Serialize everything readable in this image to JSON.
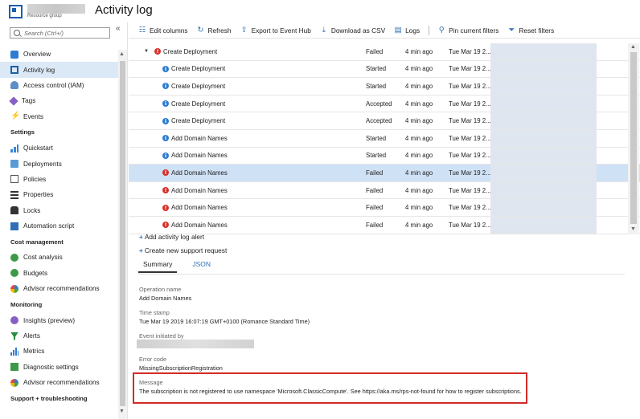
{
  "header": {
    "resource_subtitle": "Resource group",
    "page_title": "Activity log"
  },
  "sidebar": {
    "search_placeholder": "Search (Ctrl+/)",
    "collapse": "«",
    "items_top": [
      {
        "label": "Overview",
        "icon": "overview-icon"
      },
      {
        "label": "Activity log",
        "icon": "activity-log-icon",
        "active": true
      },
      {
        "label": "Access control (IAM)",
        "icon": "iam-icon"
      },
      {
        "label": "Tags",
        "icon": "tag-icon"
      },
      {
        "label": "Events",
        "icon": "lightning-icon"
      }
    ],
    "settings_header": "Settings",
    "settings_items": [
      {
        "label": "Quickstart",
        "icon": "quickstart-icon"
      },
      {
        "label": "Deployments",
        "icon": "deployments-icon"
      },
      {
        "label": "Policies",
        "icon": "policies-icon"
      },
      {
        "label": "Properties",
        "icon": "properties-icon"
      },
      {
        "label": "Locks",
        "icon": "lock-icon"
      },
      {
        "label": "Automation script",
        "icon": "automation-icon"
      }
    ],
    "cost_header": "Cost management",
    "cost_items": [
      {
        "label": "Cost analysis",
        "icon": "cost-analysis-icon"
      },
      {
        "label": "Budgets",
        "icon": "budgets-icon"
      },
      {
        "label": "Advisor recommendations",
        "icon": "advisor-icon"
      }
    ],
    "monitoring_header": "Monitoring",
    "monitoring_items": [
      {
        "label": "Insights (preview)",
        "icon": "insights-icon"
      },
      {
        "label": "Alerts",
        "icon": "alerts-icon"
      },
      {
        "label": "Metrics",
        "icon": "metrics-icon"
      },
      {
        "label": "Diagnostic settings",
        "icon": "diagnostic-icon"
      },
      {
        "label": "Advisor recommendations",
        "icon": "advisor-icon"
      }
    ],
    "support_header": "Support + troubleshooting"
  },
  "toolbar": {
    "edit_columns": "Edit columns",
    "refresh": "Refresh",
    "export": "Export to Event Hub",
    "download": "Download as CSV",
    "logs": "Logs",
    "pin": "Pin current filters",
    "reset": "Reset filters"
  },
  "events": [
    {
      "operation": "Create Deployment",
      "status": "Failed",
      "time": "4 min ago",
      "date": "Tue Mar 19 2...",
      "kind": "failed",
      "parent": true
    },
    {
      "operation": "Create Deployment",
      "status": "Started",
      "time": "4 min ago",
      "date": "Tue Mar 19 2...",
      "kind": "info"
    },
    {
      "operation": "Create Deployment",
      "status": "Started",
      "time": "4 min ago",
      "date": "Tue Mar 19 2...",
      "kind": "info"
    },
    {
      "operation": "Create Deployment",
      "status": "Accepted",
      "time": "4 min ago",
      "date": "Tue Mar 19 2...",
      "kind": "info"
    },
    {
      "operation": "Create Deployment",
      "status": "Accepted",
      "time": "4 min ago",
      "date": "Tue Mar 19 2...",
      "kind": "info"
    },
    {
      "operation": "Add Domain Names",
      "status": "Started",
      "time": "4 min ago",
      "date": "Tue Mar 19 2...",
      "kind": "info"
    },
    {
      "operation": "Add Domain Names",
      "status": "Started",
      "time": "4 min ago",
      "date": "Tue Mar 19 2...",
      "kind": "info"
    },
    {
      "operation": "Add Domain Names",
      "status": "Failed",
      "time": "4 min ago",
      "date": "Tue Mar 19 2...",
      "kind": "failed",
      "selected": true
    },
    {
      "operation": "Add Domain Names",
      "status": "Failed",
      "time": "4 min ago",
      "date": "Tue Mar 19 2...",
      "kind": "failed"
    },
    {
      "operation": "Add Domain Names",
      "status": "Failed",
      "time": "4 min ago",
      "date": "Tue Mar 19 2...",
      "kind": "failed"
    },
    {
      "operation": "Add Domain Names",
      "status": "Failed",
      "time": "4 min ago",
      "date": "Tue Mar 19 2...",
      "kind": "failed"
    }
  ],
  "actions": {
    "add_alert": "Add activity log alert",
    "support": "Create new support request"
  },
  "tabs": {
    "summary": "Summary",
    "json": "JSON"
  },
  "details": {
    "operation_name_label": "Operation name",
    "operation_name_value": "Add Domain Names",
    "timestamp_label": "Time stamp",
    "timestamp_value": "Tue Mar 19 2019 16:07:19 GMT+0100 (Romance Standard Time)",
    "initiated_label": "Event initiated by",
    "error_label": "Error code",
    "error_value": "MissingSubscriptionRegistration",
    "message_label": "Message",
    "message_value": "The subscription is not registered to use namespace 'Microsoft.ClassicCompute'. See https://aka.ms/rps-not-found for how to register subscriptions."
  },
  "colors": {
    "accent": "#2e6fb8",
    "failed": "#d9302a",
    "selected_row": "#cfe1f5",
    "highlight_border": "#d32a2a"
  }
}
